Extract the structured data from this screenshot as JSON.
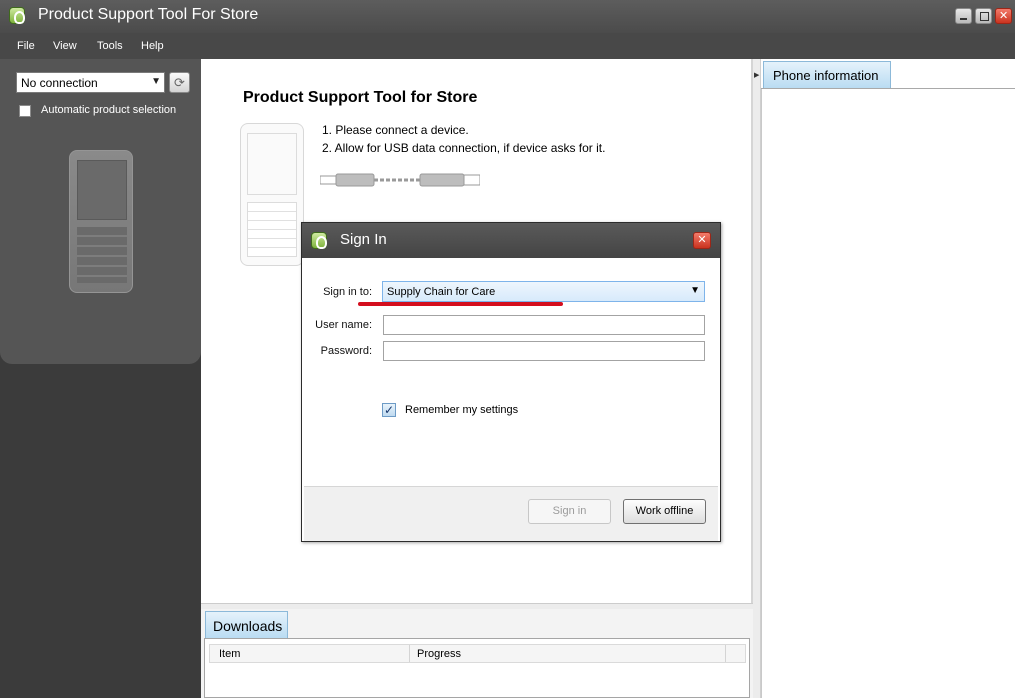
{
  "window": {
    "title": "Product Support Tool For Store"
  },
  "menu": {
    "items": [
      "File",
      "View",
      "Tools",
      "Help"
    ]
  },
  "left_panel": {
    "connection_value": "No connection",
    "auto_select_label": "Automatic product selection"
  },
  "center": {
    "title": "Product Support Tool for Store",
    "steps": [
      "1. Please connect a device.",
      "2. Allow for USB data connection, if device asks for it."
    ]
  },
  "downloads": {
    "tab_label": "Downloads",
    "columns": [
      "Item",
      "Progress"
    ]
  },
  "right_panel": {
    "tab_label": "Phone information"
  },
  "dialog": {
    "title": "Sign In",
    "sign_in_to_label": "Sign in to:",
    "sign_in_to_value": "Supply Chain for Care",
    "username_label": "User name:",
    "password_label": "Password:",
    "username_value": "",
    "password_value": "",
    "remember_label": "Remember my settings",
    "remember_checked": true,
    "sign_in_button": "Sign in",
    "work_offline_button": "Work offline"
  },
  "colors": {
    "titlebar": "#4b4b4b",
    "accent_tab": "#b8dbf2",
    "highlight_underline": "#d40e1e"
  }
}
